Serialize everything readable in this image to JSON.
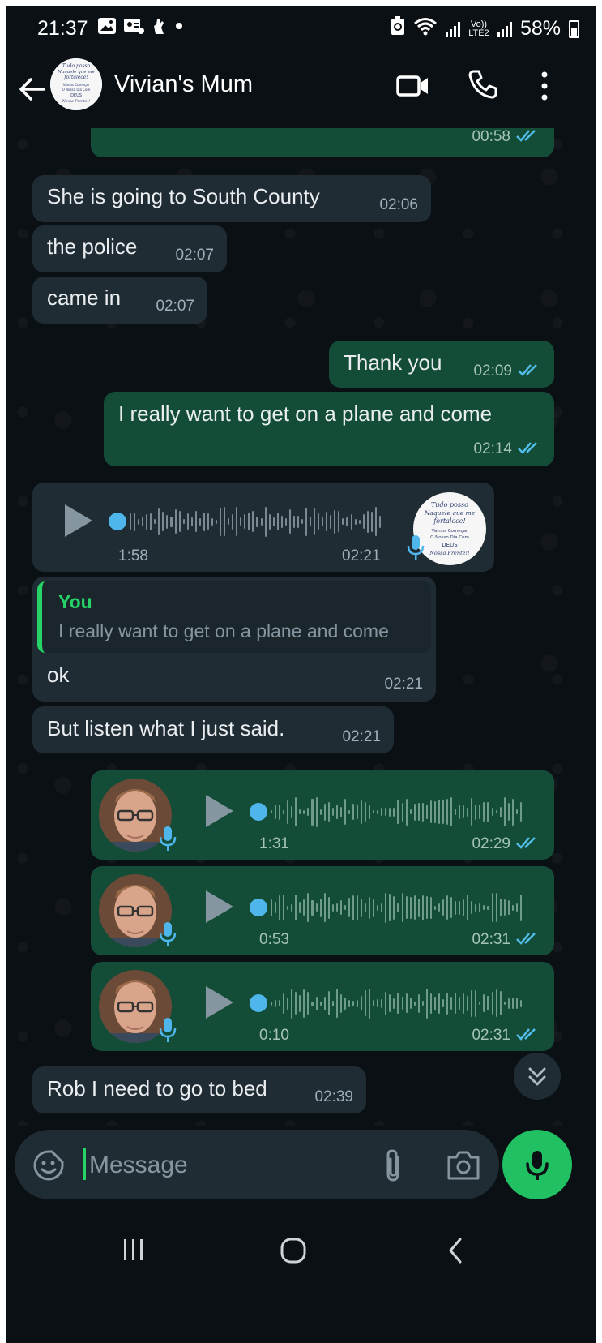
{
  "status_bar": {
    "time": "21:37",
    "battery": "58%",
    "network": "Vo)) LTE2"
  },
  "header": {
    "contact_name": "Vivian's Mum",
    "avatar_text": [
      "Tudo posso",
      "Naquele que me",
      "fortalece!",
      "Vamos Começar",
      "O Nosso Dia Com",
      "DEUS",
      "Nossa Frente!!"
    ]
  },
  "messages": [
    {
      "type": "text",
      "dir": "out",
      "text": "",
      "time": "00:58",
      "read": true
    },
    {
      "type": "text",
      "dir": "in",
      "text": "She is going to South County",
      "time": "02:06"
    },
    {
      "type": "text",
      "dir": "in",
      "text": "the police",
      "time": "02:07"
    },
    {
      "type": "text",
      "dir": "in",
      "text": "came in",
      "time": "02:07"
    },
    {
      "type": "text",
      "dir": "out",
      "text": "Thank you",
      "time": "02:09",
      "read": true
    },
    {
      "type": "text",
      "dir": "out",
      "text": "I really want to get on a plane and come",
      "time": "02:14",
      "read": true
    },
    {
      "type": "voice",
      "dir": "in",
      "duration": "1:58",
      "time": "02:21"
    },
    {
      "type": "reply",
      "dir": "in",
      "quote_author": "You",
      "quote_text": "I really want to get on a plane and come",
      "text": "ok",
      "time": "02:21"
    },
    {
      "type": "text",
      "dir": "in",
      "text": "But listen what I just said.",
      "time": "02:21"
    },
    {
      "type": "voice",
      "dir": "out",
      "duration": "1:31",
      "time": "02:29",
      "read": true
    },
    {
      "type": "voice",
      "dir": "out",
      "duration": "0:53",
      "time": "02:31",
      "read": true
    },
    {
      "type": "voice",
      "dir": "out",
      "duration": "0:10",
      "time": "02:31",
      "read": true
    },
    {
      "type": "text",
      "dir": "in",
      "text": "Rob I need to go to bed",
      "time": "02:39"
    }
  ],
  "composer": {
    "placeholder": "Message"
  },
  "colors": {
    "incoming": "#1f2c34",
    "outgoing": "#134d37",
    "accent": "#21c063",
    "tick": "#53bdeb"
  }
}
